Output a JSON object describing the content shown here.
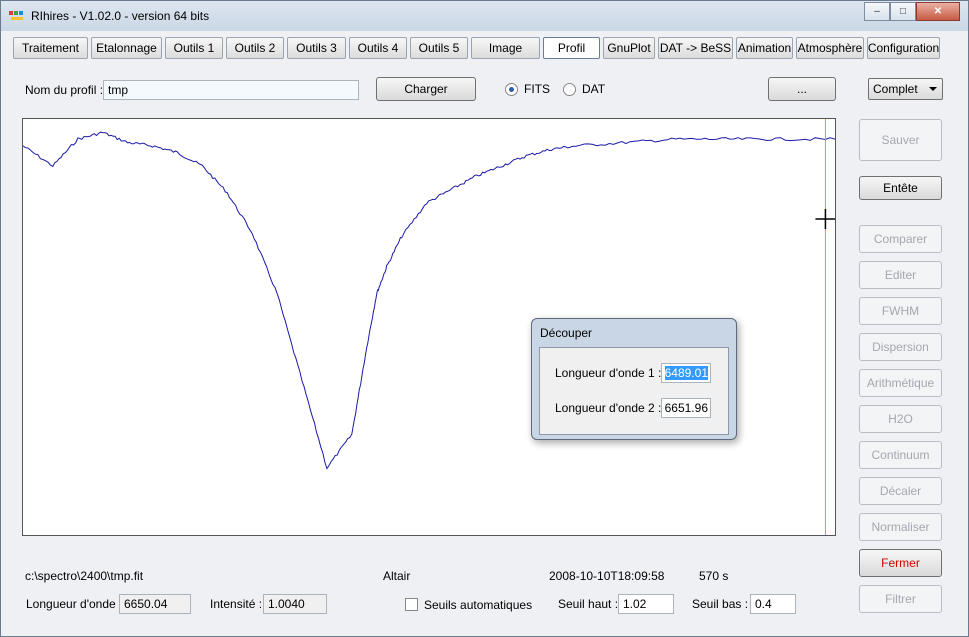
{
  "window": {
    "title": "RIhires - V1.02.0 - version 64 bits",
    "controls": {
      "minimize": "–",
      "maximize": "□",
      "close": "✕"
    }
  },
  "tabs": [
    "Traitement",
    "Etalonnage",
    "Outils 1",
    "Outils 2",
    "Outils 3",
    "Outils 4",
    "Outils 5",
    "Image",
    "Profil",
    "GnuPlot",
    "DAT -> BeSS",
    "Animation",
    "Atmosphère",
    "Configuration"
  ],
  "active_tab": "Profil",
  "profile": {
    "name_label": "Nom du profil :",
    "name_value": "tmp",
    "load_button": "Charger",
    "format_options": [
      "FITS",
      "DAT"
    ],
    "format_selected": "FITS",
    "browse_button": "...",
    "mode_select": "Complet"
  },
  "side_buttons": [
    {
      "label": "Sauver",
      "enabled": false
    },
    {
      "label": "Entête",
      "enabled": true
    },
    {
      "label": "Comparer",
      "enabled": false
    },
    {
      "label": "Editer",
      "enabled": false
    },
    {
      "label": "FWHM",
      "enabled": false
    },
    {
      "label": "Dispersion",
      "enabled": false
    },
    {
      "label": "Arithmétique",
      "enabled": false
    },
    {
      "label": "H2O",
      "enabled": false
    },
    {
      "label": "Continuum",
      "enabled": false
    },
    {
      "label": "Décaler",
      "enabled": false
    },
    {
      "label": "Normaliser",
      "enabled": false
    },
    {
      "label": "Fermer",
      "enabled": true
    },
    {
      "label": "Filtrer",
      "enabled": false
    }
  ],
  "dialog": {
    "title": "Découper",
    "wl1_label": "Longueur d'onde 1 :",
    "wl1_value": "6489.01",
    "wl2_label": "Longueur d'onde 2 :",
    "wl2_value": "6651.96"
  },
  "status": {
    "file": "c:\\spectro\\2400\\tmp.fit",
    "object": "Altair",
    "date": "2008-10-10T18:09:58",
    "exposure": "570 s",
    "wavelength_label": "Longueur d'onde :",
    "wavelength_value": "6650.04",
    "intensity_label": "Intensité :",
    "intensity_value": "1.0040",
    "auto_threshold_label": "Seuils automatiques",
    "auto_threshold_checked": false,
    "high_label": "Seuil haut :",
    "high_value": "1.02",
    "low_label": "Seuil bas :",
    "low_value": "0.4"
  },
  "chart_data": {
    "type": "line",
    "series": [
      {
        "color": "#1a1aa8",
        "x": [
          6489.01,
          6495,
          6500,
          6505,
          6510,
          6515,
          6520,
          6525,
          6530,
          6535,
          6540,
          6545,
          6550,
          6555,
          6558,
          6560,
          6562,
          6565,
          6570,
          6575,
          6580,
          6585,
          6590,
          6595,
          6600,
          6610,
          6620,
          6630,
          6640,
          6651.96
        ],
        "y": [
          0.98,
          0.95,
          0.99,
          1.0,
          0.985,
          0.98,
          0.97,
          0.95,
          0.91,
          0.85,
          0.76,
          0.63,
          0.5,
          0.55,
          0.68,
          0.76,
          0.8,
          0.845,
          0.895,
          0.915,
          0.935,
          0.95,
          0.965,
          0.975,
          0.98,
          0.985,
          0.99,
          0.99,
          0.99,
          0.99
        ]
      }
    ],
    "cursor_x": 6650.04,
    "xlim": [
      6489.01,
      6651.96
    ],
    "ylim": [
      0.4,
      1.02
    ],
    "grid": false
  }
}
